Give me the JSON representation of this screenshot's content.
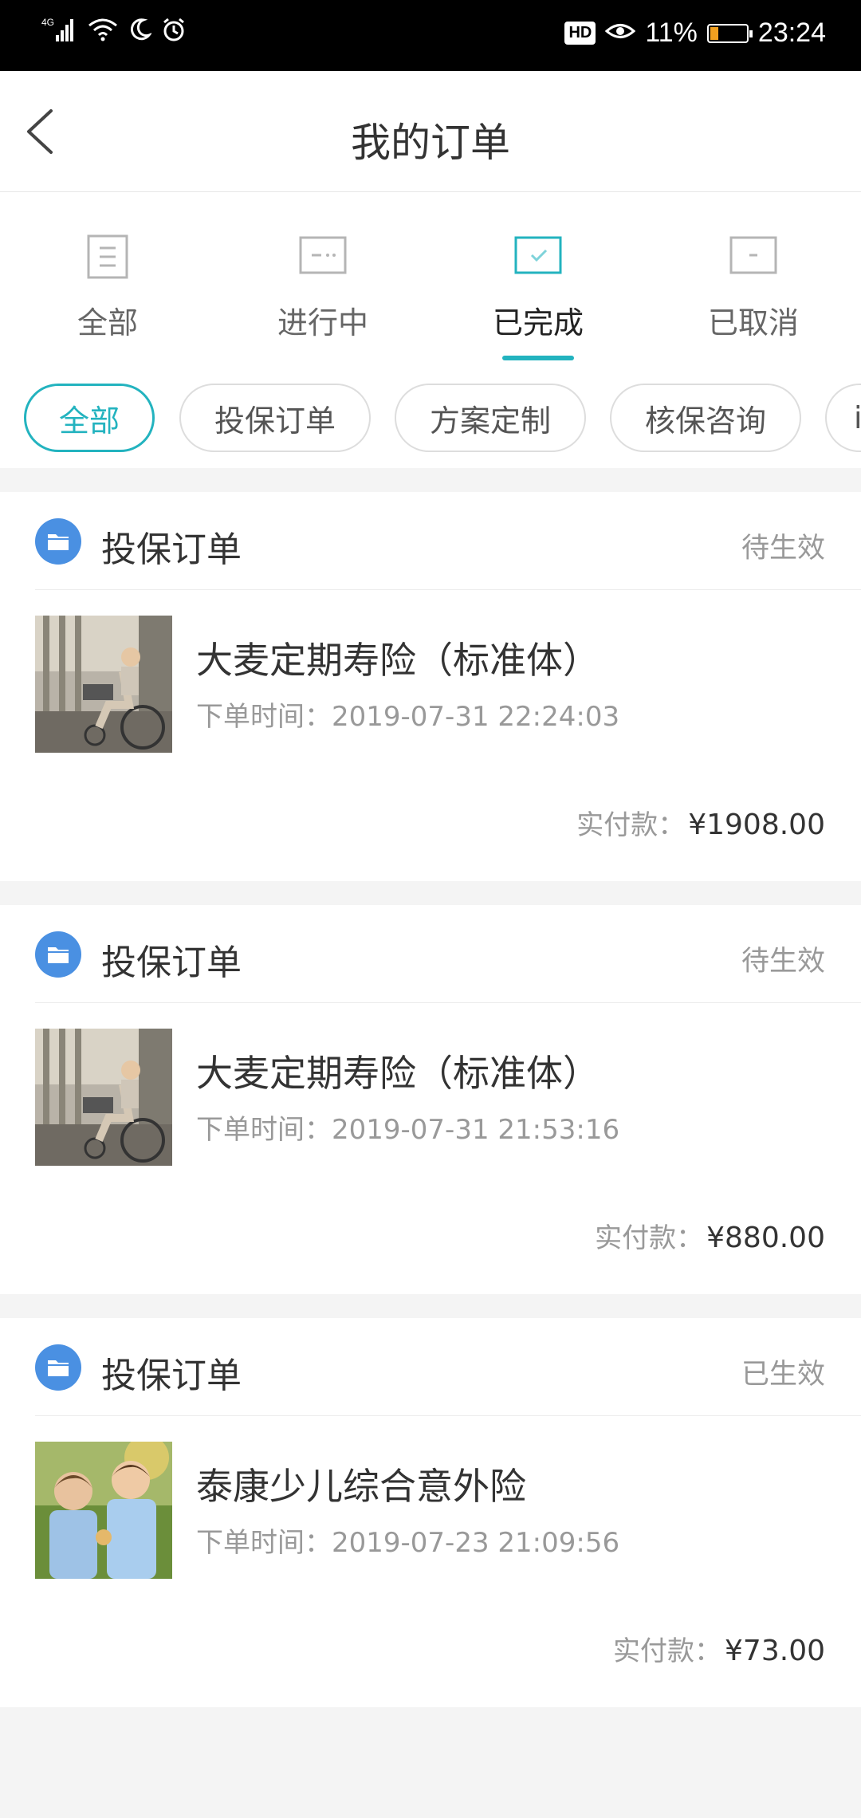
{
  "status_bar": {
    "network": "4G",
    "hd": "HD",
    "battery_percent": "11%",
    "time": "23:24"
  },
  "header": {
    "title": "我的订单"
  },
  "status_tabs": [
    {
      "label": "全部",
      "icon": "list-doc-icon"
    },
    {
      "label": "进行中",
      "icon": "ellipsis-doc-icon"
    },
    {
      "label": "已完成",
      "icon": "check-doc-icon",
      "active": true
    },
    {
      "label": "已取消",
      "icon": "minus-doc-icon"
    }
  ],
  "filter_chips": [
    {
      "label": "全部",
      "active": true
    },
    {
      "label": "投保订单"
    },
    {
      "label": "方案定制"
    },
    {
      "label": "核保咨询"
    },
    {
      "label": "i"
    }
  ],
  "orders": [
    {
      "type": "投保订单",
      "state": "待生效",
      "product": "大麦定期寿险（标准体）",
      "time_label": "下单时间：",
      "time": "2019-07-31 22:24:03",
      "pay_label": "实付款：",
      "amount": "¥1908.00",
      "image": "elderly-man-wheelchair"
    },
    {
      "type": "投保订单",
      "state": "待生效",
      "product": "大麦定期寿险（标准体）",
      "time_label": "下单时间：",
      "time": "2019-07-31 21:53:16",
      "pay_label": "实付款：",
      "amount": "¥880.00",
      "image": "elderly-man-wheelchair"
    },
    {
      "type": "投保订单",
      "state": "已生效",
      "product": "泰康少儿综合意外险",
      "time_label": "下单时间：",
      "time": "2019-07-23 21:09:56",
      "pay_label": "实付款：",
      "amount": "¥73.00",
      "image": "two-children"
    }
  ],
  "colors": {
    "accent": "#23b3bf",
    "folder_icon": "#4a90e2",
    "muted_text": "#999999"
  }
}
